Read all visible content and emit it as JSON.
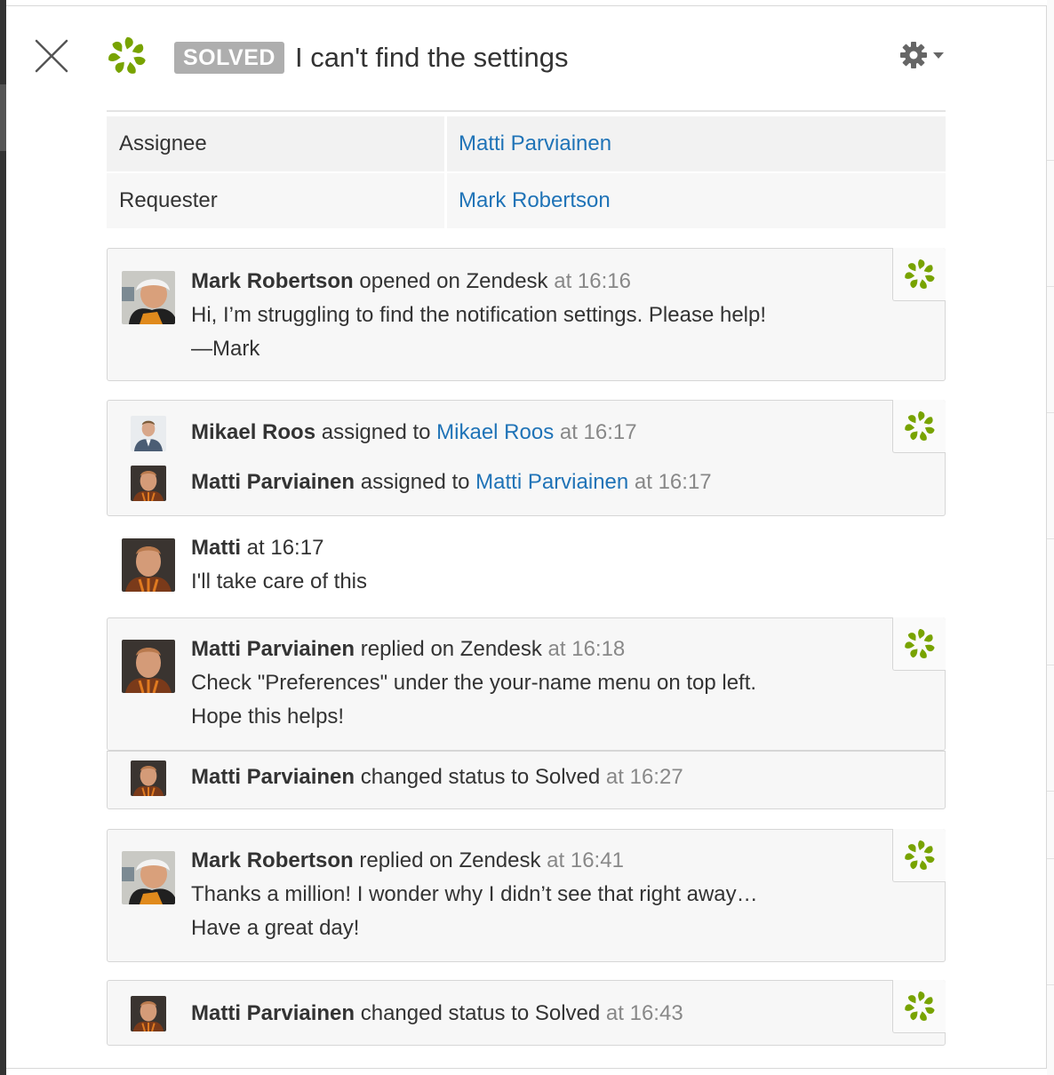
{
  "header": {
    "status_badge": "SOLVED",
    "title": "I can't find the settings"
  },
  "properties": [
    {
      "label": "Assignee",
      "value": "Matti Parviainen"
    },
    {
      "label": "Requester",
      "value": "Mark Robertson"
    }
  ],
  "events": {
    "e1": {
      "author": "Mark Robertson",
      "action": " opened on Zendesk ",
      "time": "at 16:16",
      "line1": "Hi, I’m struggling to find the notification settings. Please help!",
      "line2": "—Mark"
    },
    "e2": {
      "author": "Mikael Roos",
      "action": " assigned to ",
      "target": "Mikael Roos",
      "time": " at 16:17"
    },
    "e3": {
      "author": "Matti Parviainen",
      "action": " assigned to ",
      "target": "Matti Parviainen",
      "time": " at 16:17"
    },
    "e4": {
      "author": "Matti",
      "action": " at 16:17",
      "line1": "I'll take care of this"
    },
    "e5": {
      "author": "Matti Parviainen",
      "action": " replied on Zendesk ",
      "time": "at 16:18",
      "line1": "Check \"Preferences\" under the your-name menu on top left.",
      "line2": "Hope this helps!"
    },
    "e6": {
      "author": "Matti Parviainen",
      "action": " changed status to Solved ",
      "time": "at 16:27"
    },
    "e7": {
      "author": "Mark Robertson",
      "action": " replied on Zendesk ",
      "time": "at 16:41",
      "line1": "Thanks a million! I wonder why I didn’t see that right away…",
      "line2": "Have a great day!"
    },
    "e8": {
      "author": "Matti Parviainen",
      "action": " changed status to Solved ",
      "time": "at 16:43"
    }
  },
  "colors": {
    "brand_green": "#78a300",
    "link_blue": "#1f73b7",
    "badge_gray": "#aeaeae"
  },
  "icons": [
    "close-icon",
    "zendesk-logo-icon",
    "gear-icon",
    "chevron-down-icon",
    "zendesk-source-icon"
  ]
}
